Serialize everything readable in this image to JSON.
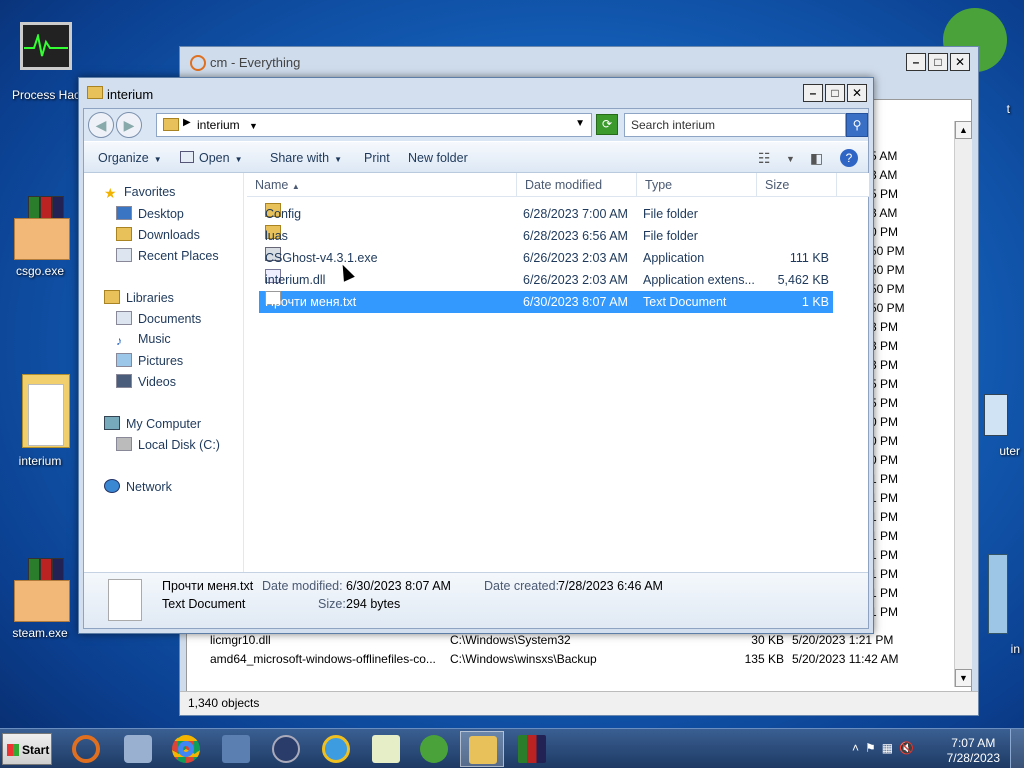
{
  "desktop": {
    "icons": [
      {
        "label": "Process Hac"
      },
      {
        "label": "csgo.exe"
      },
      {
        "label": "interium"
      },
      {
        "label": "steam.exe"
      },
      {
        "label": "t"
      },
      {
        "label": "uter"
      },
      {
        "label": "in"
      }
    ]
  },
  "everything": {
    "title": "cm - Everything",
    "right_times": [
      "5 AM",
      "3 AM",
      "5 PM",
      "3 AM",
      "0 PM",
      "50 PM",
      "50 PM",
      "50 PM",
      "50 PM",
      "3 PM",
      "3 PM",
      "3 PM",
      "5 PM",
      "5 PM",
      "0 PM",
      "0 PM",
      "0 PM",
      "1 PM",
      "1 PM",
      "1 PM",
      "1 PM",
      "1 PM",
      "1 PM",
      "1 PM",
      "1 PM"
    ],
    "rows": [
      {
        "name": "licmgr10.dll",
        "path": "C:\\Windows\\System32",
        "size": "30 KB",
        "date": "5/20/2023 1:21 PM"
      },
      {
        "name": "amd64_microsoft-windows-offlinefiles-co...",
        "path": "C:\\Windows\\winsxs\\Backup",
        "size": "135 KB",
        "date": "5/20/2023 11:42 AM"
      }
    ],
    "status": "1,340 objects"
  },
  "explorer": {
    "title": "interium",
    "address": "interium",
    "search_placeholder": "Search interium",
    "commands": {
      "organize": "Organize",
      "open": "Open",
      "share": "Share with",
      "print": "Print",
      "new_folder": "New folder"
    },
    "nav": {
      "favorites": "Favorites",
      "desktop": "Desktop",
      "downloads": "Downloads",
      "recent": "Recent Places",
      "libraries": "Libraries",
      "documents": "Documents",
      "music": "Music",
      "pictures": "Pictures",
      "videos": "Videos",
      "computer": "My Computer",
      "localdisk": "Local Disk (C:)",
      "network": "Network"
    },
    "columns": {
      "name": "Name",
      "date": "Date modified",
      "type": "Type",
      "size": "Size"
    },
    "files": [
      {
        "name": "Config",
        "date": "6/28/2023 7:00 AM",
        "type": "File folder",
        "size": "",
        "icon": "folder-icon"
      },
      {
        "name": "luas",
        "date": "6/28/2023 6:56 AM",
        "type": "File folder",
        "size": "",
        "icon": "folder-icon"
      },
      {
        "name": "CSGhost-v4.3.1.exe",
        "date": "6/26/2023 2:03 AM",
        "type": "Application",
        "size": "111 KB",
        "icon": "application-icon"
      },
      {
        "name": "interium.dll",
        "date": "6/26/2023 2:03 AM",
        "type": "Application extens...",
        "size": "5,462 KB",
        "icon": "dll-icon"
      },
      {
        "name": "Прочти меня.txt",
        "date": "6/30/2023 8:07 AM",
        "type": "Text Document",
        "size": "1 KB",
        "icon": "text-file-icon"
      }
    ],
    "details": {
      "filename": "Прочти меня.txt",
      "filetype": "Text Document",
      "modified_label": "Date modified:",
      "modified": "6/30/2023 8:07 AM",
      "created_label": "Date created:",
      "created": "7/28/2023 6:46 AM",
      "size_label": "Size:",
      "size": "294 bytes"
    }
  },
  "taskbar": {
    "start": "Start",
    "time": "7:07 AM",
    "date": "7/28/2023"
  },
  "colors": {
    "selection": "#3399ff",
    "taskbar": "#1e3a64"
  }
}
